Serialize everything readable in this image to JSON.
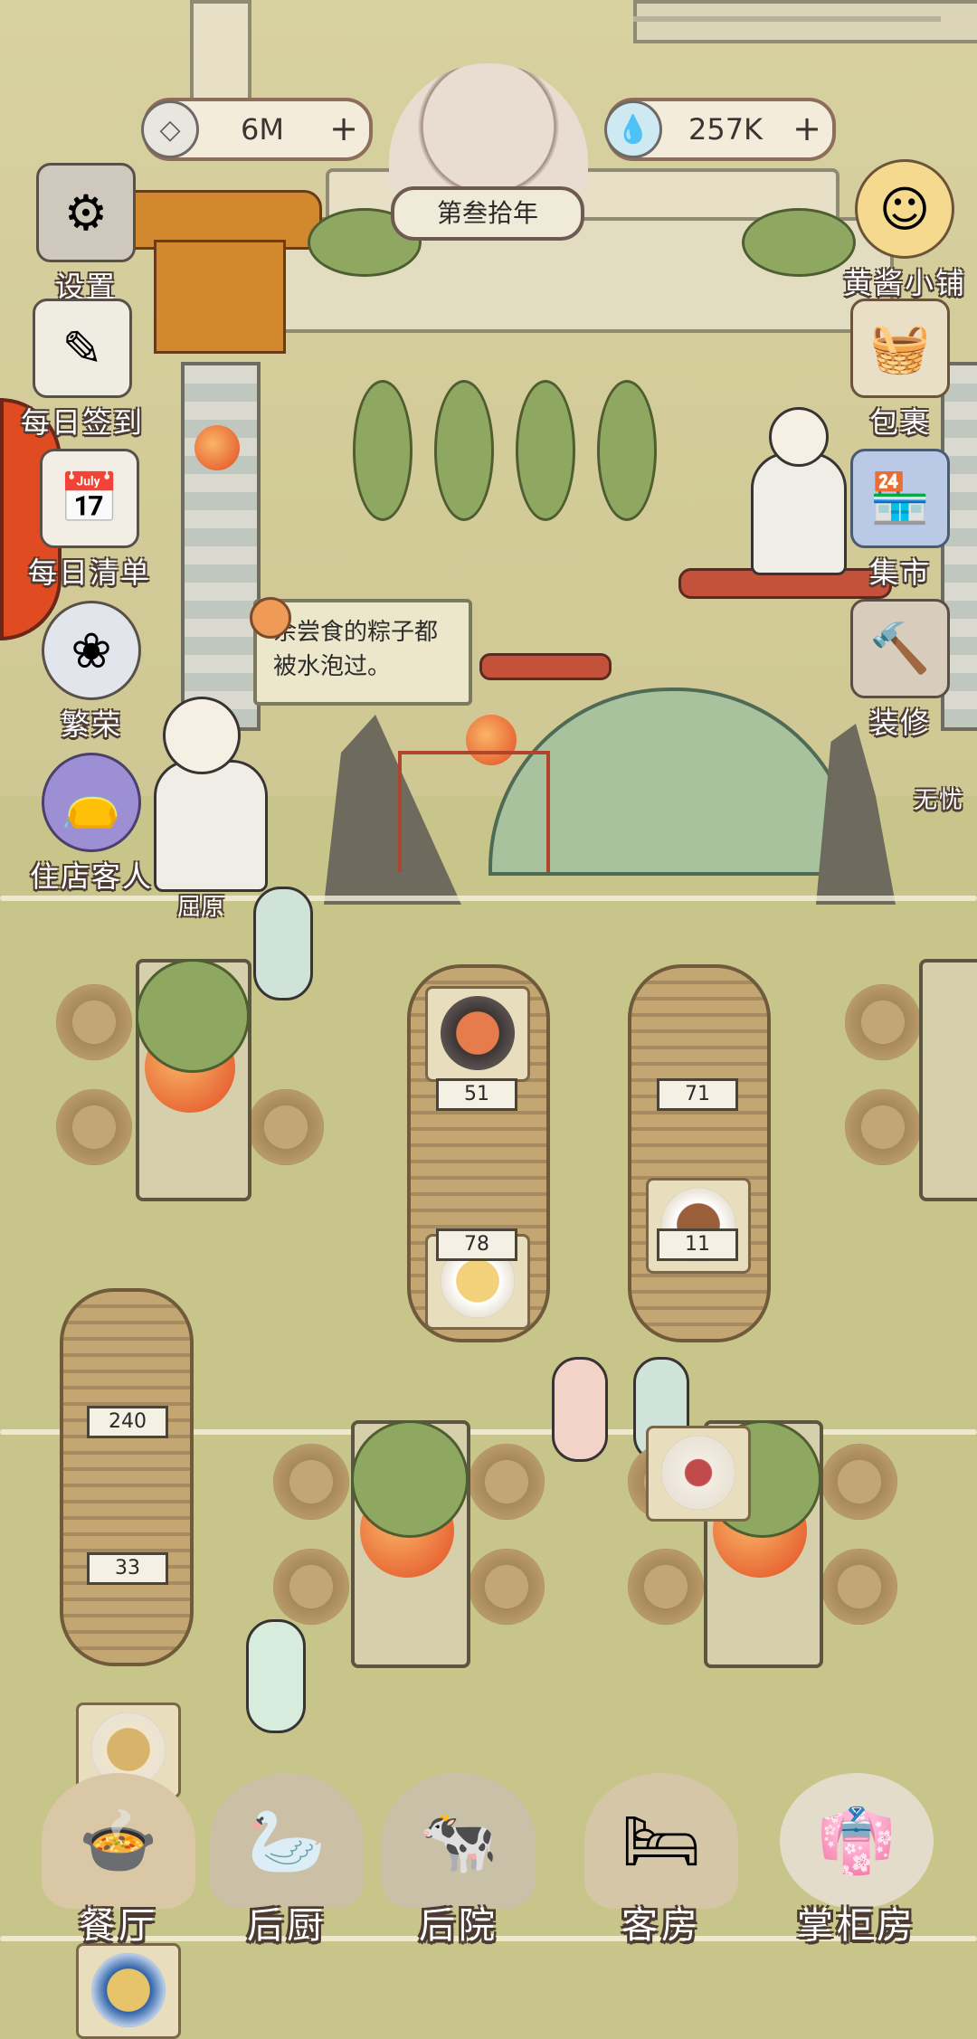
{
  "currency": {
    "coins": {
      "value": "6M",
      "icon": "coin-icon",
      "plus": "+"
    },
    "water": {
      "value": "257K",
      "icon": "water-drop-icon",
      "plus": "+"
    }
  },
  "year_label": "第叁拾年",
  "left_menu": [
    {
      "label": "设置",
      "icon": "box-gear-icon",
      "glyph": "⚙"
    },
    {
      "label": "每日签到",
      "icon": "brush-scroll-icon",
      "glyph": "✎"
    },
    {
      "label": "每日清单",
      "icon": "calendar-icon",
      "glyph": "📅"
    },
    {
      "label": "繁荣",
      "icon": "prosperity-icon",
      "glyph": "❀"
    },
    {
      "label": "住店客人",
      "icon": "guest-bag-icon",
      "glyph": "👝"
    }
  ],
  "right_menu": [
    {
      "label": "黄酱小铺",
      "icon": "shop-girl-icon",
      "glyph": "☺"
    },
    {
      "label": "包裹",
      "icon": "basket-icon",
      "glyph": "🧺"
    },
    {
      "label": "集市",
      "icon": "market-stall-icon",
      "glyph": "🏪"
    },
    {
      "label": "装修",
      "icon": "hammer-icon",
      "glyph": "🔨"
    }
  ],
  "edge_label": "无忧",
  "speech": {
    "text": "余尝食的粽子都被水泡过。"
  },
  "character_name": "屈原",
  "dish_counts": {
    "boat1": [
      "51",
      "78"
    ],
    "boat2": [
      "71",
      "11"
    ],
    "boat3": [
      "240",
      "33"
    ]
  },
  "bottom_nav": [
    {
      "label": "餐厅",
      "icon": "restaurant-icon",
      "glyph": "🍲"
    },
    {
      "label": "后厨",
      "icon": "kitchen-icon",
      "glyph": "🦢"
    },
    {
      "label": "后院",
      "icon": "backyard-icon",
      "glyph": "🐄"
    },
    {
      "label": "客房",
      "icon": "guest-room-icon",
      "glyph": "🛏"
    },
    {
      "label": "掌柜房",
      "icon": "manager-room-icon",
      "glyph": "👘"
    }
  ],
  "colors": {
    "wall": "#d8d1a0",
    "floor": "#c8c58a",
    "accent": "#e24c23",
    "outline": "#4b3b33"
  }
}
